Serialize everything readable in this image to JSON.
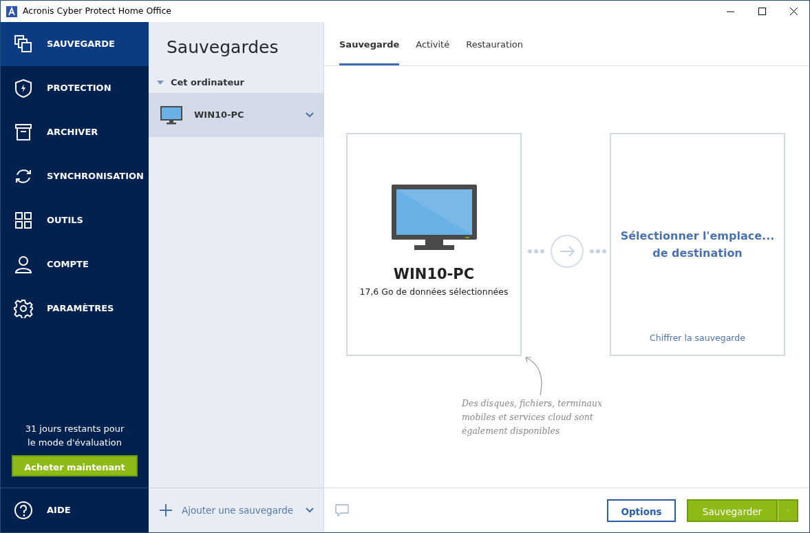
{
  "window": {
    "title": "Acronis Cyber Protect Home Office"
  },
  "sidebar": {
    "items": [
      {
        "label": "SAUVEGARDE",
        "selected": true
      },
      {
        "label": "PROTECTION",
        "selected": false
      },
      {
        "label": "ARCHIVER",
        "selected": false
      },
      {
        "label": "SYNCHRONISATION",
        "selected": false
      },
      {
        "label": "OUTILS",
        "selected": false
      },
      {
        "label": "COMPTE",
        "selected": false
      },
      {
        "label": "PARAMÈTRES",
        "selected": false
      }
    ],
    "trial_notice": [
      "31 jours restants pour",
      "le mode d'évaluation"
    ],
    "buy_button": "Acheter maintenant",
    "help": "AIDE"
  },
  "backups_panel": {
    "title": "Sauvegardes",
    "groups": [
      {
        "label": "Cet ordinateur",
        "expanded": true,
        "items": [
          {
            "name": "WIN10-PC",
            "selected": true
          }
        ]
      }
    ],
    "add_button": "Ajouter une sauvegarde"
  },
  "tabs": [
    {
      "label": "Sauvegarde",
      "selected": true
    },
    {
      "label": "Activité",
      "selected": false
    },
    {
      "label": "Restauration",
      "selected": false
    }
  ],
  "source": {
    "name": "WIN10-PC",
    "details": "17,6 Go de données sélectionnées"
  },
  "destination": {
    "label": [
      "Sélectionner l'emplace...",
      "de destination"
    ],
    "link": "Chiffrer la sauvegarde"
  },
  "hint": [
    "Des disques, fichiers, terminaux",
    "mobiles et services cloud sont",
    "également disponibles"
  ],
  "footer": {
    "options_button": "Options",
    "backup_button": "Sauvegarder"
  }
}
